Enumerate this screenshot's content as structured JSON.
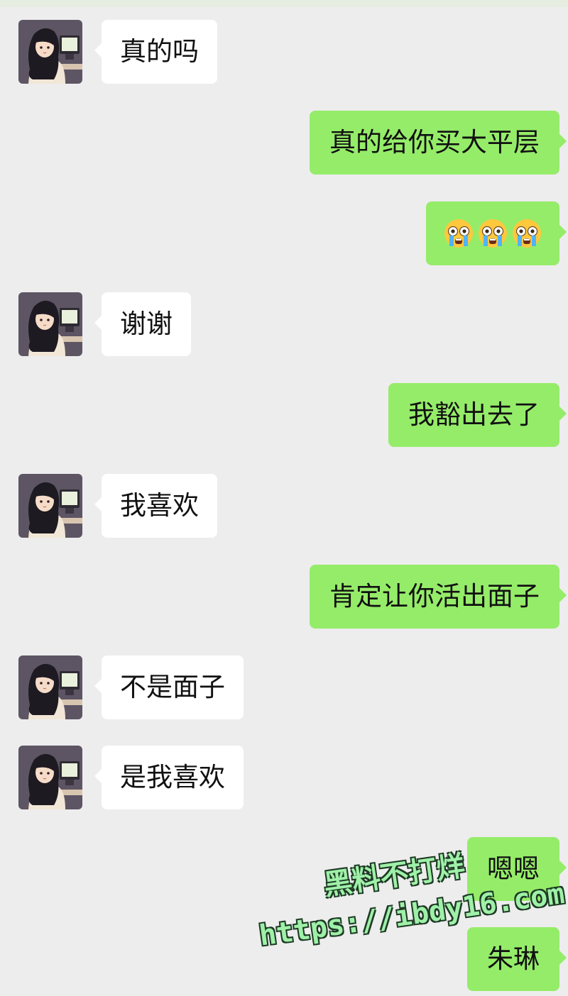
{
  "messages": [
    {
      "side": "left",
      "text": "真的吗"
    },
    {
      "side": "right",
      "text": "真的给你买大平层"
    },
    {
      "side": "right",
      "emoji": "crying-face",
      "emoji_count": 3
    },
    {
      "side": "left",
      "text": "谢谢"
    },
    {
      "side": "right",
      "text": "我豁出去了"
    },
    {
      "side": "left",
      "text": "我喜欢"
    },
    {
      "side": "right",
      "text": "肯定让你活出面子"
    },
    {
      "side": "left",
      "text": "不是面子"
    },
    {
      "side": "left",
      "text": "是我喜欢"
    },
    {
      "side": "right",
      "text": "嗯嗯"
    },
    {
      "side": "right",
      "text": "朱琳"
    }
  ],
  "watermark": {
    "line1": "黑料不打烊",
    "line2": "https://ibdy16.com"
  },
  "colors": {
    "background": "#ededed",
    "sent_bubble": "#95ec69",
    "received_bubble": "#ffffff",
    "text": "#111111"
  },
  "icons": {
    "avatar": "girl-at-computer-avatar",
    "emoji": "crying-face-emoji"
  }
}
